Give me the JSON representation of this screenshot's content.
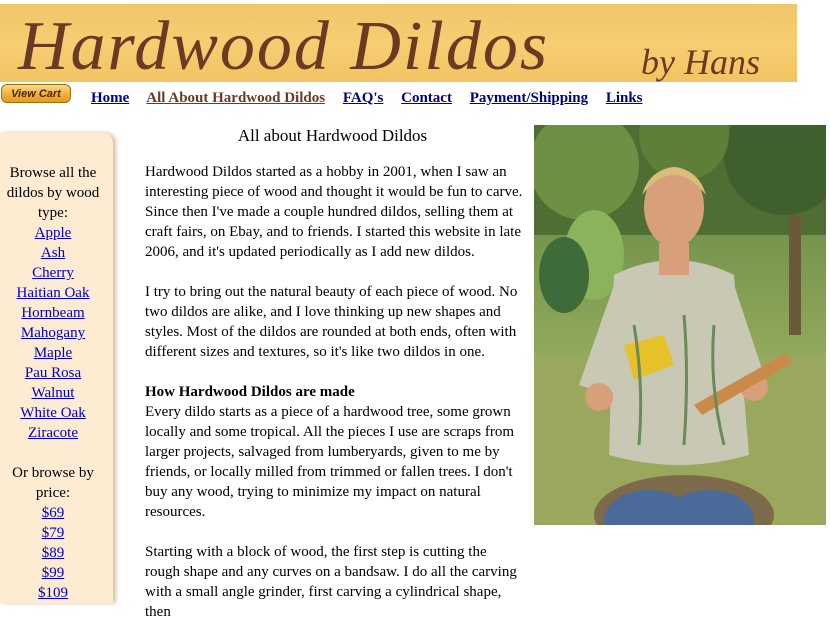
{
  "banner": {
    "title": "Hardwood Dildos",
    "by": "by Hans"
  },
  "cart": {
    "label": "View Cart"
  },
  "nav": [
    {
      "label": "Home"
    },
    {
      "label": "All About Hardwood Dildos"
    },
    {
      "label": "FAQ's"
    },
    {
      "label": "Contact"
    },
    {
      "label": "Payment/Shipping"
    },
    {
      "label": "Links"
    }
  ],
  "sidebar": {
    "wood_heading": "Browse all the dildos by wood type:",
    "woods": [
      "Apple",
      "Ash",
      "Cherry",
      "Haitian Oak",
      "Hornbeam",
      "Mahogany",
      "Maple",
      "Pau Rosa",
      "Walnut",
      "White Oak",
      "Ziracote"
    ],
    "price_heading": "Or browse by price:",
    "prices": [
      "$69",
      "$79",
      "$89",
      "$99",
      "$109"
    ]
  },
  "main": {
    "heading": "All about Hardwood Dildos",
    "p1": "Hardwood Dildos started as a hobby in 2001, when I saw an interesting piece of wood and thought it would be fun to carve. Since then I've made a couple hundred dildos, selling them at craft fairs, on Ebay, and to friends. I started this website in late 2006, and it's updated periodically as I add new dildos.",
    "p2": "I try to bring out the natural beauty of each piece of wood. No two dildos are alike, and I love thinking up new shapes and styles. Most of the dildos are rounded at both ends, often with different sizes and textures, so it's like two dildos in one.",
    "p3_heading": "How Hardwood Dildos are made",
    "p3": "Every dildo starts as a piece of a hardwood tree, some grown locally and some tropical. All the pieces I use are scraps from larger projects, salvaged from lumberyards, given to me by friends, or locally milled from trimmed or fallen trees. I don't buy any wood, trying to minimize my impact on natural resources.",
    "p4": "Starting with a block of wood, the first step is cutting the rough shape and any curves on a bandsaw. I do all the carving with a small angle grinder, first carving a cylindrical shape, then"
  }
}
